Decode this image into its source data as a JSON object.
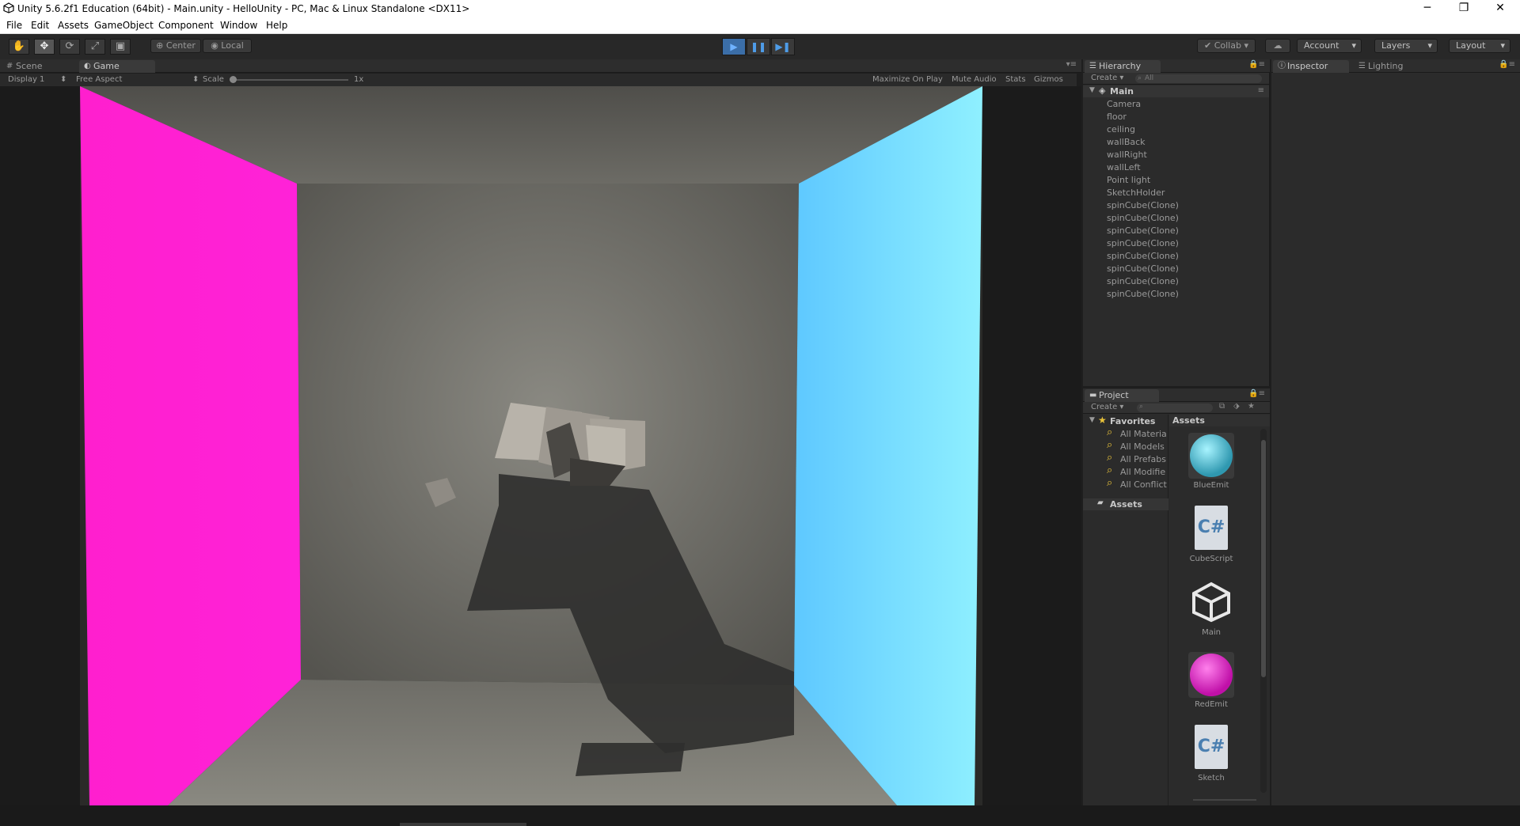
{
  "window": {
    "title": "Unity 5.6.2f1 Education (64bit) - Main.unity - HelloUnity - PC, Mac & Linux Standalone <DX11>",
    "controls": [
      "─",
      "❐",
      "✕"
    ]
  },
  "menu": [
    "File",
    "Edit",
    "Assets",
    "GameObject",
    "Component",
    "Window",
    "Help"
  ],
  "toolbar": {
    "tools": [
      "hand-icon",
      "move-icon",
      "rotate-icon",
      "scale-icon",
      "rect-icon"
    ],
    "pivot": "Center",
    "space": "Local",
    "play_icons": [
      "▶",
      "❚❚",
      "▶❚"
    ],
    "collab": "Collab",
    "account": "Account",
    "layers": "Layers",
    "layout": "Layout"
  },
  "tabs": {
    "scene": "Scene",
    "game": "Game"
  },
  "game_bar": {
    "display": "Display 1",
    "aspect": "Free Aspect",
    "scale_label": "Scale",
    "scale_value": "1x",
    "maximize": "Maximize On Play",
    "mute": "Mute Audio",
    "stats": "Stats",
    "gizmos": "Gizmos"
  },
  "hierarchy": {
    "title": "Hierarchy",
    "create": "Create",
    "search_placeholder": "All",
    "scene": "Main",
    "items": [
      "Camera",
      "floor",
      "ceiling",
      "wallBack",
      "wallRight",
      "wallLeft",
      "Point light",
      "SketchHolder",
      "spinCube(Clone)",
      "spinCube(Clone)",
      "spinCube(Clone)",
      "spinCube(Clone)",
      "spinCube(Clone)",
      "spinCube(Clone)",
      "spinCube(Clone)",
      "spinCube(Clone)"
    ]
  },
  "inspector": {
    "title": "Inspector",
    "lighting": "Lighting"
  },
  "project": {
    "title": "Project",
    "create": "Create",
    "favorites": "Favorites",
    "fav_items": [
      "All Materia",
      "All Models",
      "All Prefabs",
      "All Modifie",
      "All Conflict"
    ],
    "assets_folder": "Assets",
    "assets_header": "Assets",
    "assets": [
      "BlueEmit",
      "CubeScript",
      "Main",
      "RedEmit",
      "Sketch"
    ]
  },
  "colors": {
    "magenta_wall": "#ff1fce",
    "cyan_wall": "#6fd4ff",
    "room": "#6b6a64",
    "accent_play": "#3b6ea8"
  }
}
